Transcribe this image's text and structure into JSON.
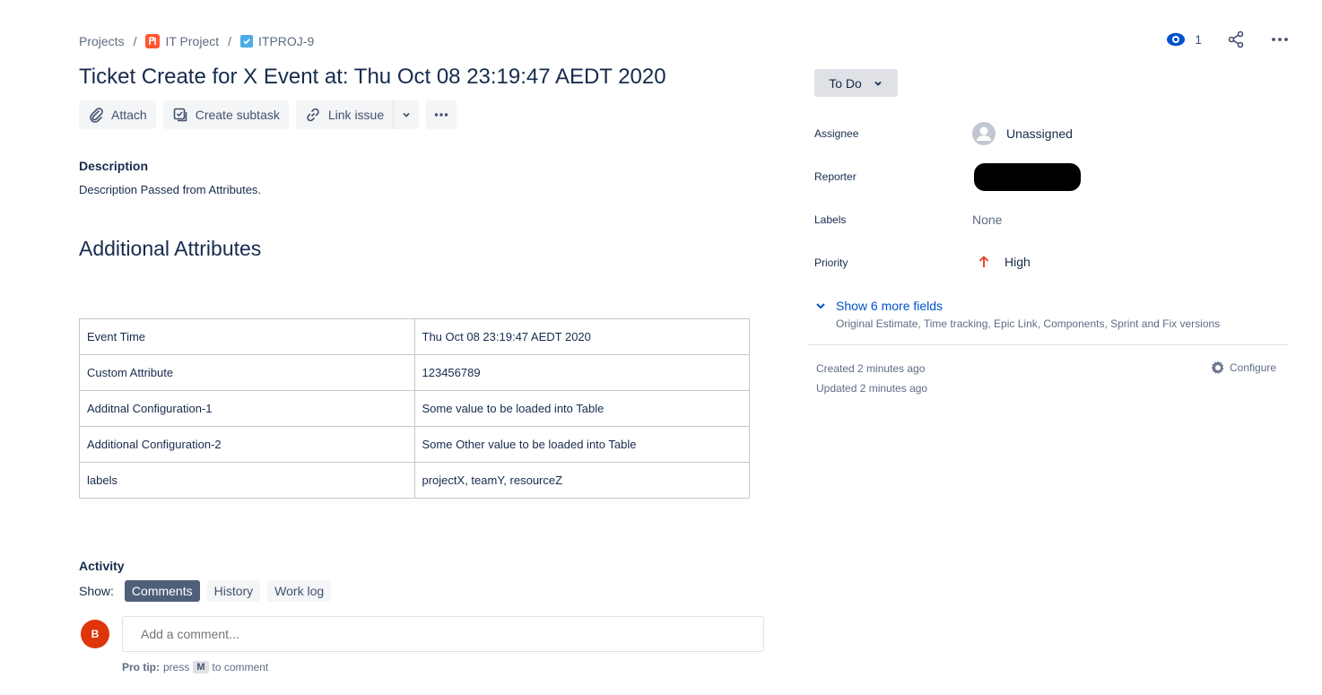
{
  "breadcrumb": {
    "root": "Projects",
    "project": "IT Project",
    "issue_key": "ITPROJ-9",
    "separator": "/"
  },
  "issue": {
    "title": "Ticket Create for X Event at: Thu Oct 08 23:19:47 AEDT 2020"
  },
  "toolbar": {
    "attach": "Attach",
    "create_subtask": "Create subtask",
    "link_issue": "Link issue"
  },
  "description": {
    "heading": "Description",
    "text": "Description Passed from Attributes."
  },
  "additional": {
    "heading": "Additional Attributes",
    "rows": [
      {
        "key": "Event Time",
        "value": "Thu Oct 08 23:19:47 AEDT 2020"
      },
      {
        "key": "Custom Attribute",
        "value": "123456789"
      },
      {
        "key": "Additnal Configuration-1",
        "value": "Some value to be loaded into Table"
      },
      {
        "key": "Additional Configuration-2",
        "value": "Some Other value to be loaded into Table"
      },
      {
        "key": "labels",
        "value": "projectX, teamY, resourceZ"
      }
    ]
  },
  "activity": {
    "heading": "Activity",
    "show_label": "Show:",
    "tabs": [
      "Comments",
      "History",
      "Work log"
    ],
    "active_tab": "Comments",
    "avatar_initial": "B",
    "comment_placeholder": "Add a comment...",
    "protip_label": "Pro tip:",
    "protip_press": "press",
    "protip_key": "M",
    "protip_suffix": "to comment"
  },
  "header_actions": {
    "watchers_count": "1"
  },
  "status": {
    "label": "To Do"
  },
  "fields": {
    "assignee_label": "Assignee",
    "assignee_value": "Unassigned",
    "reporter_label": "Reporter",
    "labels_label": "Labels",
    "labels_value": "None",
    "priority_label": "Priority",
    "priority_value": "High"
  },
  "more_fields": {
    "label": "Show 6 more fields",
    "sub": "Original Estimate, Time tracking, Epic Link, Components, Sprint and Fix versions"
  },
  "meta": {
    "created": "Created 2 minutes ago",
    "updated": "Updated 2 minutes ago",
    "configure": "Configure"
  },
  "colors": {
    "text": "#172b4d",
    "link": "#0052cc",
    "priority_high": "#e5493a",
    "avatar_b": "#de350b",
    "project_icon": "#ff5630",
    "task_icon": "#4bade8"
  }
}
